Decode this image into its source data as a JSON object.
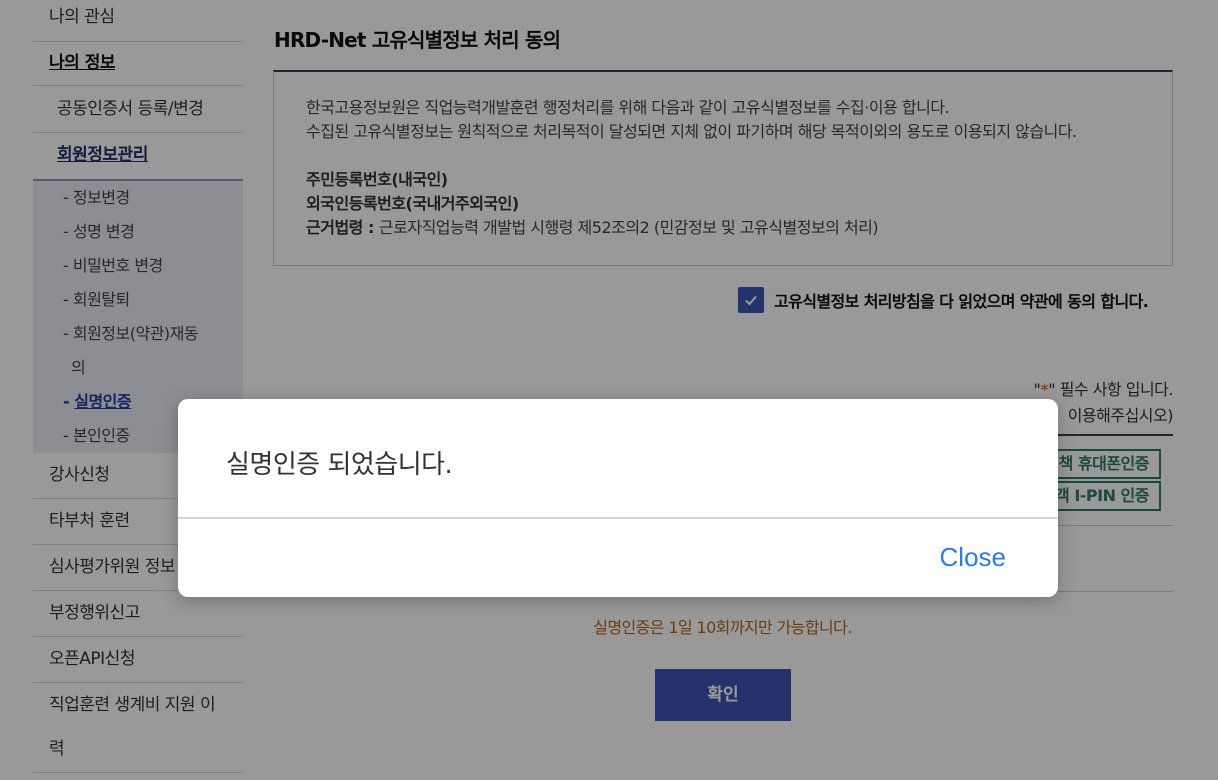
{
  "sidebar": {
    "items": [
      {
        "label": "나의 관심"
      },
      {
        "label": "나의 정보"
      },
      {
        "label": "공동인증서 등록/변경"
      },
      {
        "label": "회원정보관리"
      },
      {
        "label": "강사신청"
      },
      {
        "label": "타부처 훈련"
      },
      {
        "label": "심사평가위원 정보"
      },
      {
        "label": "부정행위신고"
      },
      {
        "label": "오픈API신청"
      },
      {
        "label": "직업훈련 생계비 지원 이"
      },
      {
        "label": "력"
      }
    ],
    "sub_items": [
      {
        "label": "- 정보변경"
      },
      {
        "label": "- 성명 변경"
      },
      {
        "label": "- 비밀번호 변경"
      },
      {
        "label": "- 회원탈퇴"
      },
      {
        "label": "- 회원정보(약관)재동"
      },
      {
        "label": "의"
      },
      {
        "label": "- 실명인증",
        "prefix": "- ",
        "text": "실명인증"
      },
      {
        "label": "- 본인인증"
      }
    ]
  },
  "main": {
    "title": "HRD-Net 고유식별정보 처리 동의",
    "agreement": {
      "line1": "한국고용정보원은 직업능력개발훈련 행정처리를 위해 다음과 같이 고유식별정보를 수집·이용 합니다.",
      "line2": "수집된 고유식별정보는 원칙적으로 처리목적이 달성되면 지체 없이 파기하며 해당 목적이외의 용도로 이용되지 않습니다.",
      "item1": "주민등록번호(내국인)",
      "item2": "외국인등록번호(국내거주외국인)",
      "law_label": "근거법령 : ",
      "law_text": "근로자직업능력 개발법 시행령 제52조의2 (민감정보 및 고유식별정보의 처리)"
    },
    "agree_checkbox_label": "고유식별정보 처리방침을 다 읽었으며 약관에 동의 합니다.",
    "required_note_open": "\"",
    "required_star": "*",
    "required_note_close": "\" 필수 사항 입니다.",
    "use_note": "이용해주십시오)",
    "verify_phone_label": "책 휴대폰인증",
    "verify_ipin_label": "객 I-PIN 인증",
    "limit_note": "실명인증은 1일 10회까지만 가능합니다.",
    "confirm_label": "확인"
  },
  "modal": {
    "message": "실명인증 되었습니다.",
    "close_label": "Close"
  },
  "colors": {
    "brand_blue": "#3d55b5",
    "close_link": "#2f7be0",
    "verify_green": "#2f7a66",
    "warning_orange": "#b5651d"
  }
}
